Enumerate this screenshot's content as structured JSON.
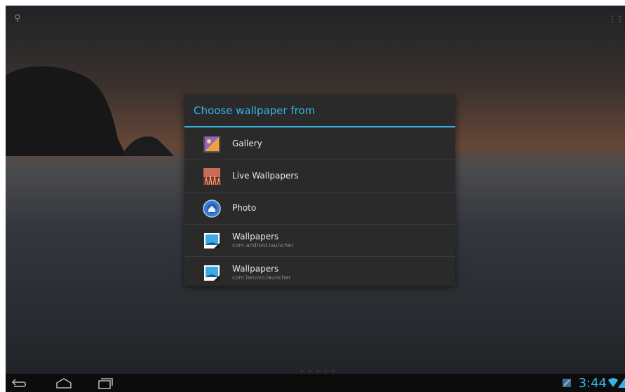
{
  "dialog": {
    "title": "Choose wallpaper from",
    "items": [
      {
        "label": "Gallery",
        "sub": "",
        "icon": "gallery-icon"
      },
      {
        "label": "Live Wallpapers",
        "sub": "",
        "icon": "live-wallpapers-icon"
      },
      {
        "label": "Photo",
        "sub": "",
        "icon": "photo-icon"
      },
      {
        "label": "Wallpapers",
        "sub": "com.android.launcher",
        "icon": "wallpapers-icon"
      },
      {
        "label": "Wallpapers",
        "sub": "com.lenovo.launcher",
        "icon": "wallpapers-icon"
      }
    ]
  },
  "status": {
    "time": "3:44"
  },
  "nav": {
    "buttons": [
      "back-icon",
      "home-icon",
      "recents-icon"
    ]
  },
  "colors": {
    "accent": "#33b5e5",
    "dialog_bg": "#2a2a2b"
  }
}
